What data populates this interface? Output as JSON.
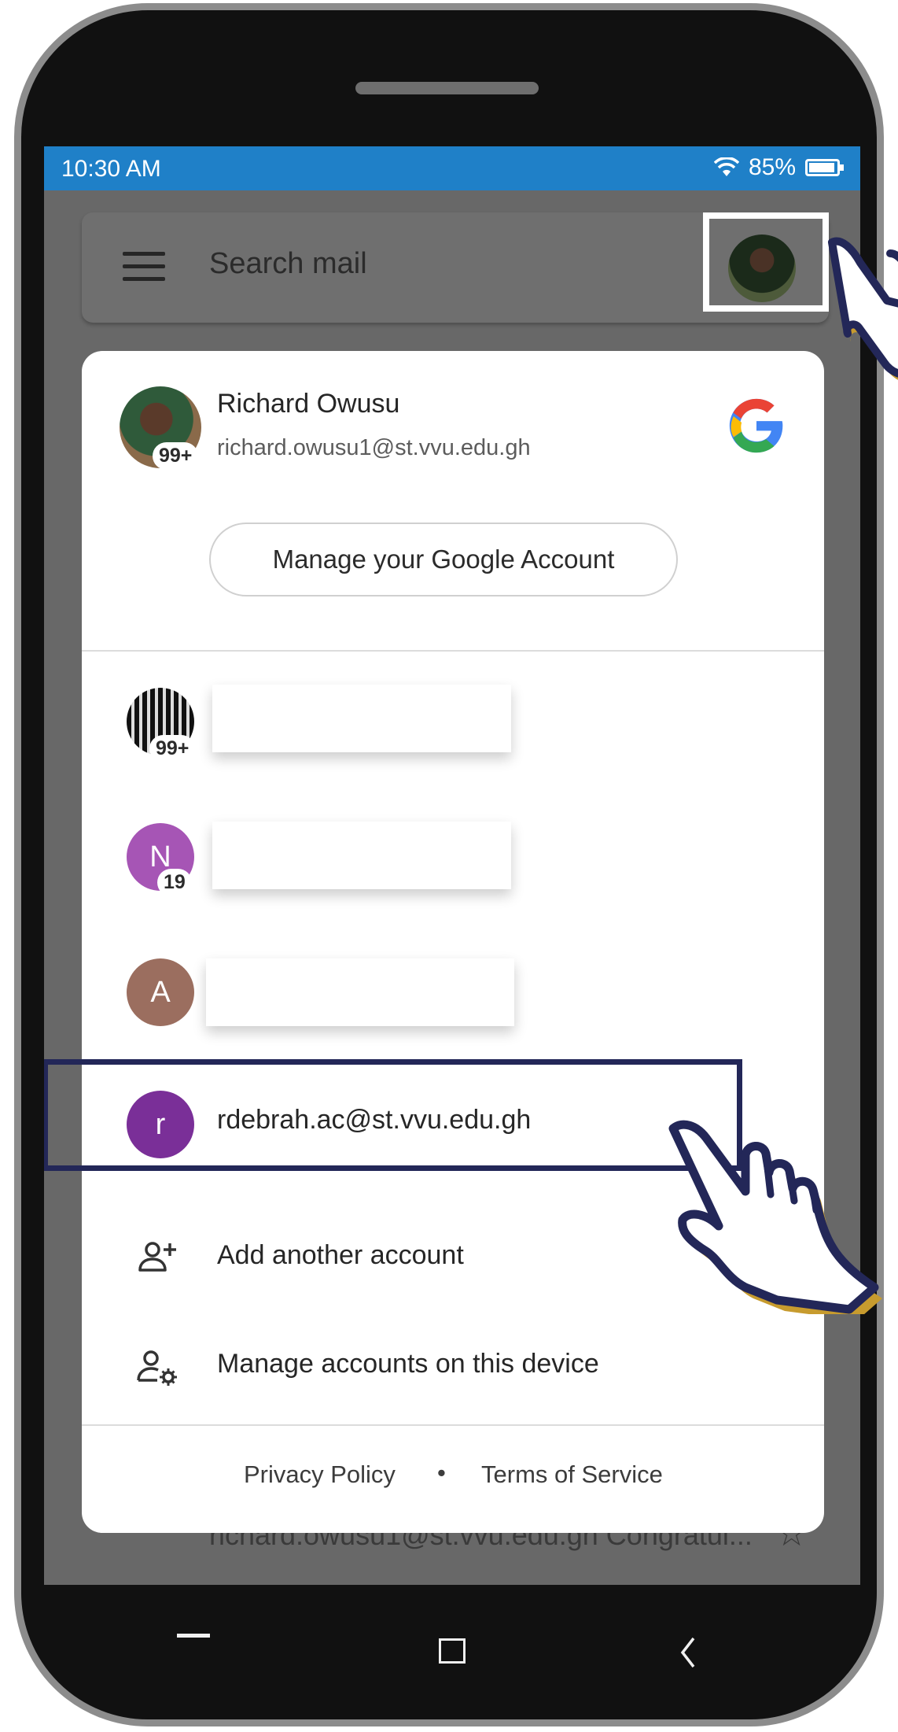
{
  "status_bar": {
    "time": "10:30 AM",
    "battery": "85%",
    "battery_level": 0.85
  },
  "search": {
    "placeholder": "Search mail"
  },
  "background_list": {
    "preview_text": "richard.owusu1@st.vvu.edu.gh Congratul..."
  },
  "account_card": {
    "user_name": "Richard Owusu",
    "user_email": "richard.owusu1@st.vvu.edu.gh",
    "main_badge": "99+",
    "manage_button": "Manage your Google Account",
    "accounts": [
      {
        "badge": "99+",
        "avatar_color": "#1a1a1a"
      },
      {
        "initial": "N",
        "badge": "19",
        "avatar_color": "#a655b5"
      },
      {
        "initial": "A",
        "avatar_color": "#9b6e5f"
      },
      {
        "initial": "r",
        "email": "rdebrah.ac@st.vvu.edu.gh",
        "avatar_color": "#7a2f98"
      }
    ],
    "add_account": "Add another account",
    "manage_device": "Manage accounts on this device",
    "privacy": "Privacy Policy",
    "separator": "•",
    "terms": "Terms of Service"
  },
  "icons": {
    "menu": "hamburger-menu-icon",
    "wifi": "wifi-icon",
    "battery": "battery-icon",
    "google": "google-logo",
    "add_person": "person-add-icon",
    "manage": "person-gear-icon",
    "pointer": "pointing-hand-icon"
  },
  "colors": {
    "status_bar": "#1f80c8",
    "highlight_frame": "#232758",
    "hand_shadow": "#c79b2e"
  }
}
